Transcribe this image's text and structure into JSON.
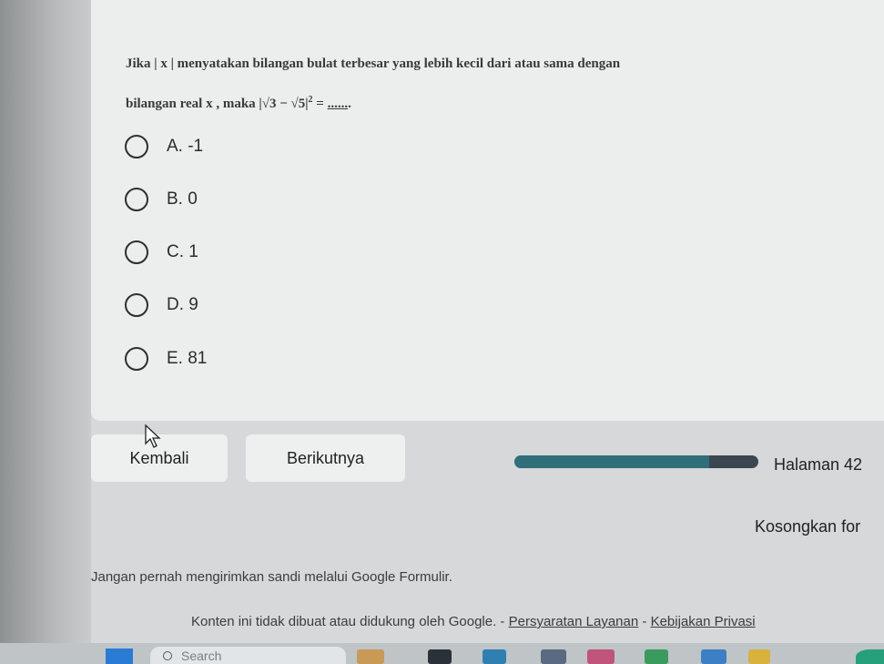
{
  "question": {
    "line1": "Jika | x | menyatakan bilangan bulat terbesar yang lebih kecil dari atau sama dengan",
    "line2_prefix": "bilangan real x , maka |√3 − √5|",
    "line2_exp": "2",
    "line2_equals": " = ",
    "line2_blank": "......",
    "line2_end": "."
  },
  "options": [
    {
      "label": "A. -1"
    },
    {
      "label": "B. 0"
    },
    {
      "label": "C. 1"
    },
    {
      "label": "D. 9"
    },
    {
      "label": "E. 81"
    }
  ],
  "nav": {
    "back_label": "Kembali",
    "next_label": "Berikutnya",
    "page_label": "Halaman 42",
    "clear_label": "Kosongkan for",
    "progress": 0.8
  },
  "warning": "Jangan pernah mengirimkan sandi melalui Google Formulir.",
  "footer": {
    "text": "Konten ini tidak dibuat atau didukung oleh Google.",
    "sep1": " - ",
    "terms": "Persyaratan Layanan",
    "sep2": " - ",
    "privacy": "Kebijakan Privasi"
  },
  "taskbar": {
    "search_placeholder": "Search",
    "start_icon": "windows-start-icon"
  },
  "colors": {
    "progress_fill": "#2e6f7a",
    "progress_track": "#3b4650",
    "start_blue": "#2a7bd3"
  }
}
